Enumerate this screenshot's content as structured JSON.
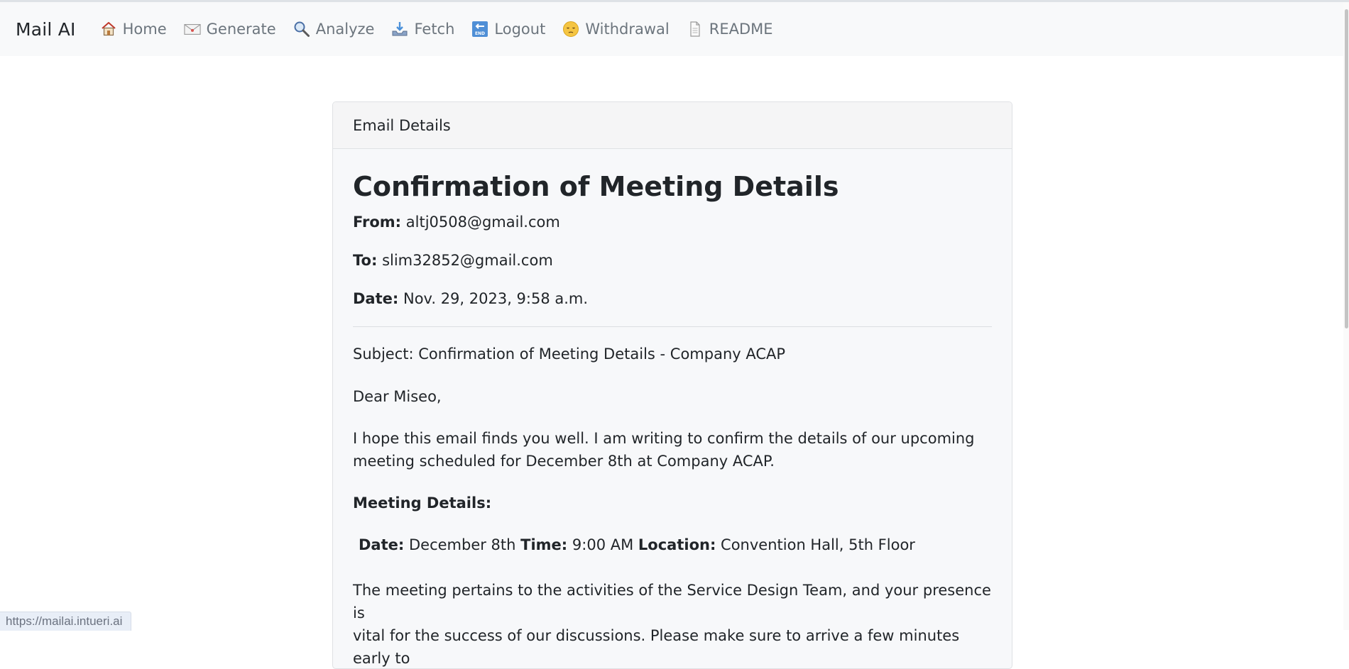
{
  "navbar": {
    "brand": "Mail AI",
    "items": [
      {
        "label": "Home",
        "icon": "house-icon"
      },
      {
        "label": "Generate",
        "icon": "envelope-icon"
      },
      {
        "label": "Analyze",
        "icon": "magnifier-icon"
      },
      {
        "label": "Fetch",
        "icon": "inbox-tray-icon"
      },
      {
        "label": "Logout",
        "icon": "end-arrow-icon"
      },
      {
        "label": "Withdrawal",
        "icon": "pensive-face-icon"
      },
      {
        "label": "README",
        "icon": "document-icon"
      }
    ]
  },
  "card": {
    "header": "Email Details",
    "title": "Confirmation of Meeting Details",
    "from_label": "From:",
    "from_value": "altj0508@gmail.com",
    "to_label": "To:",
    "to_value": "slim32852@gmail.com",
    "date_label": "Date:",
    "date_value": "Nov. 29, 2023, 9:58 a.m.",
    "body": {
      "subject_line": "Subject: Confirmation of Meeting Details - Company ACAP",
      "greeting": "Dear Miseo,",
      "intro_line1": "I hope this email finds you well. I am writing to confirm the details of our upcoming",
      "intro_line2": "meeting scheduled for December 8th at Company ACAP.",
      "meeting_heading": "Meeting Details:",
      "detail_date_label": "Date:",
      "detail_date_value": "December 8th",
      "detail_time_label": "Time:",
      "detail_time_value": "9:00 AM",
      "detail_location_label": "Location:",
      "detail_location_value": "Convention Hall, 5th Floor",
      "closing_line1": "The meeting pertains to the activities of the Service Design Team, and your presence is",
      "closing_line2": "vital for the success of our discussions. Please make sure to arrive a few minutes early to"
    }
  },
  "status_url": "https://mailai.intueri.ai",
  "colors": {
    "navbar_bg": "#f8f9fa",
    "nav_text": "#6c757d",
    "card_bg": "#f7f8fa",
    "text": "#212529"
  }
}
